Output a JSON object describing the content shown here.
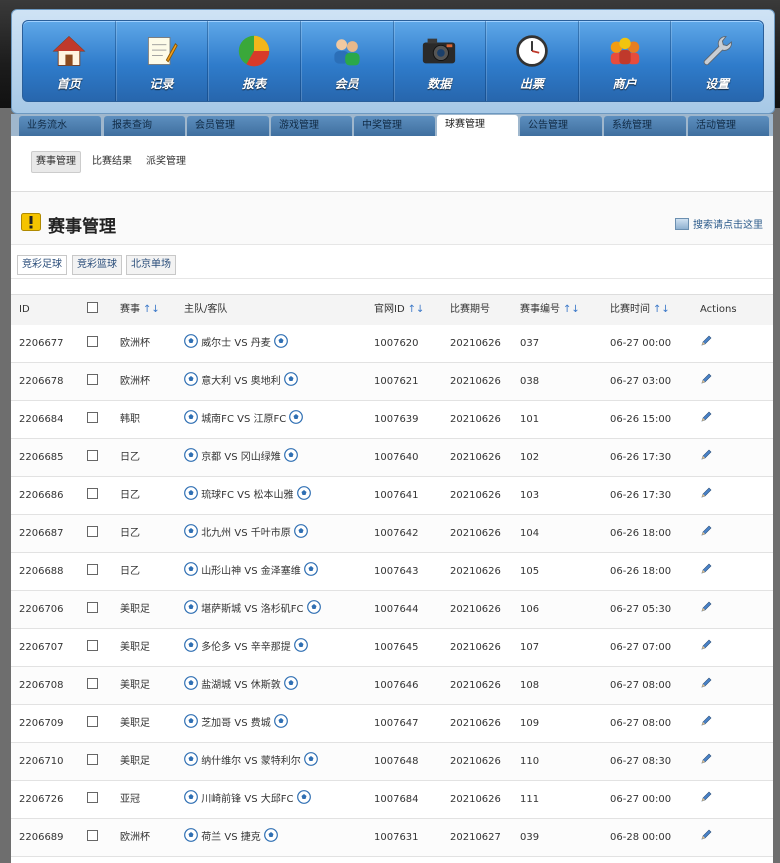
{
  "nav": [
    {
      "label": "首页",
      "icon": "home-icon"
    },
    {
      "label": "记录",
      "icon": "notepad-icon"
    },
    {
      "label": "报表",
      "icon": "pie-chart-icon"
    },
    {
      "label": "会员",
      "icon": "users-icon"
    },
    {
      "label": "数据",
      "icon": "camera-icon"
    },
    {
      "label": "出票",
      "icon": "clock-icon"
    },
    {
      "label": "商户",
      "icon": "merchant-icon"
    },
    {
      "label": "设置",
      "icon": "wrench-icon"
    }
  ],
  "tabs": [
    "业务流水",
    "报表查询",
    "会员管理",
    "游戏管理",
    "中奖管理",
    "球赛管理",
    "公告管理",
    "系统管理",
    "活动管理"
  ],
  "active_tab": "球赛管理",
  "subnav": [
    "赛事管理",
    "比赛结果",
    "派奖管理"
  ],
  "page_title": "赛事管理",
  "search_link": "搜索请点击这里",
  "type_tabs": [
    "竞彩足球",
    "竞彩篮球",
    "北京单场"
  ],
  "table": {
    "headers": {
      "id": "ID",
      "league": "赛事",
      "teams": "主队/客队",
      "official_id": "官网ID",
      "period": "比赛期号",
      "match_no": "赛事编号",
      "time": "比赛时间",
      "actions": "Actions"
    },
    "sort_arrows": "↑↓",
    "vs": "VS",
    "rows": [
      {
        "id": "2206677",
        "league": "欧洲杯",
        "home": "威尔士",
        "away": "丹麦",
        "official_id": "1007620",
        "period": "20210626",
        "match_no": "037",
        "time": "06-27 00:00"
      },
      {
        "id": "2206678",
        "league": "欧洲杯",
        "home": "意大利",
        "away": "奥地利",
        "official_id": "1007621",
        "period": "20210626",
        "match_no": "038",
        "time": "06-27 03:00"
      },
      {
        "id": "2206684",
        "league": "韩职",
        "home": "城南FC",
        "away": "江原FC",
        "official_id": "1007639",
        "period": "20210626",
        "match_no": "101",
        "time": "06-26 15:00"
      },
      {
        "id": "2206685",
        "league": "日乙",
        "home": "京都",
        "away": "冈山绿雉",
        "official_id": "1007640",
        "period": "20210626",
        "match_no": "102",
        "time": "06-26 17:30"
      },
      {
        "id": "2206686",
        "league": "日乙",
        "home": "琉球FC",
        "away": "松本山雅",
        "official_id": "1007641",
        "period": "20210626",
        "match_no": "103",
        "time": "06-26 17:30"
      },
      {
        "id": "2206687",
        "league": "日乙",
        "home": "北九州",
        "away": "千叶市原",
        "official_id": "1007642",
        "period": "20210626",
        "match_no": "104",
        "time": "06-26 18:00"
      },
      {
        "id": "2206688",
        "league": "日乙",
        "home": "山形山神",
        "away": "金泽塞维",
        "official_id": "1007643",
        "period": "20210626",
        "match_no": "105",
        "time": "06-26 18:00"
      },
      {
        "id": "2206706",
        "league": "美职足",
        "home": "堪萨斯城",
        "away": "洛杉矶FC",
        "official_id": "1007644",
        "period": "20210626",
        "match_no": "106",
        "time": "06-27 05:30"
      },
      {
        "id": "2206707",
        "league": "美职足",
        "home": "多伦多",
        "away": "辛辛那提",
        "official_id": "1007645",
        "period": "20210626",
        "match_no": "107",
        "time": "06-27 07:00"
      },
      {
        "id": "2206708",
        "league": "美职足",
        "home": "盐湖城",
        "away": "休斯敦",
        "official_id": "1007646",
        "period": "20210626",
        "match_no": "108",
        "time": "06-27 08:00"
      },
      {
        "id": "2206709",
        "league": "美职足",
        "home": "芝加哥",
        "away": "费城",
        "official_id": "1007647",
        "period": "20210626",
        "match_no": "109",
        "time": "06-27 08:00"
      },
      {
        "id": "2206710",
        "league": "美职足",
        "home": "纳什维尔",
        "away": "蒙特利尔",
        "official_id": "1007648",
        "period": "20210626",
        "match_no": "110",
        "time": "06-27 08:30"
      },
      {
        "id": "2206726",
        "league": "亚冠",
        "home": "川崎前锋",
        "away": "大邱FC",
        "official_id": "1007684",
        "period": "20210626",
        "match_no": "111",
        "time": "06-27 00:00"
      },
      {
        "id": "2206689",
        "league": "欧洲杯",
        "home": "荷兰",
        "away": "捷克",
        "official_id": "1007631",
        "period": "20210627",
        "match_no": "039",
        "time": "06-28 00:00"
      }
    ]
  },
  "colors": {
    "nav_blue": "#2f7ccb",
    "link": "#2b5a8a",
    "sort_arrow": "#3b78c8"
  }
}
